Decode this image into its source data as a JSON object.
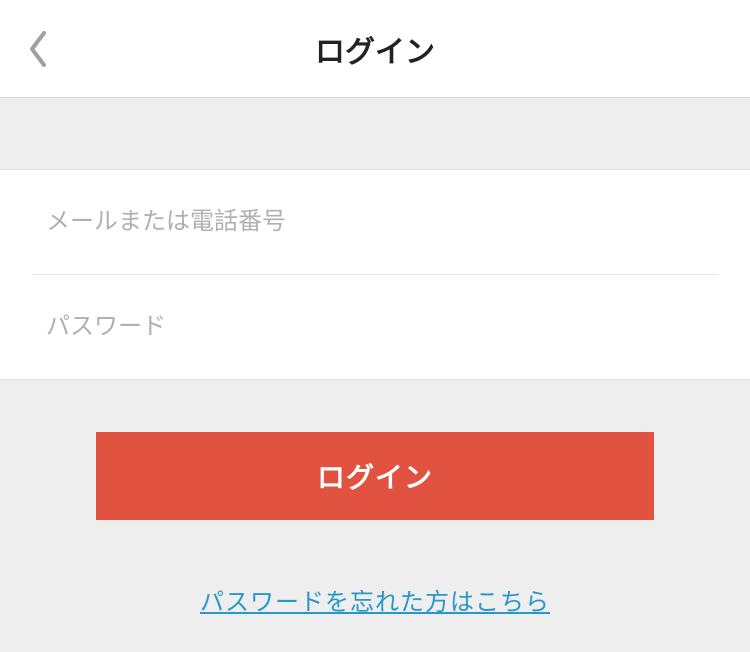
{
  "header": {
    "title": "ログイン"
  },
  "form": {
    "email_placeholder": "メールまたは電話番号",
    "password_placeholder": "パスワード",
    "email_value": "",
    "password_value": ""
  },
  "actions": {
    "login_label": "ログイン",
    "forgot_password_label": "パスワードを忘れた方はこちら"
  },
  "colors": {
    "primary_button": "#e15241",
    "link": "#2898c8"
  }
}
